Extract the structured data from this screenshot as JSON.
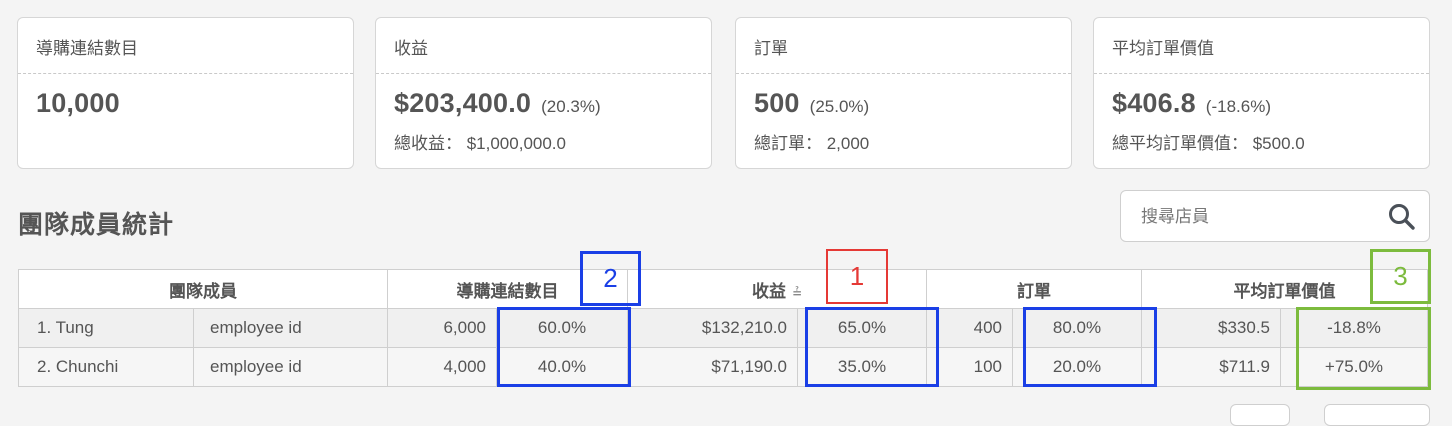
{
  "cards": [
    {
      "title": "導購連結數目",
      "value": "10,000",
      "change": "",
      "sub": ""
    },
    {
      "title": "收益",
      "value": "$203,400.0",
      "change": "(20.3%)",
      "sub": "總收益： $1,000,000.0"
    },
    {
      "title": "訂單",
      "value": "500",
      "change": "(25.0%)",
      "sub": "總訂單： 2,000"
    },
    {
      "title": "平均訂單價值",
      "value": "$406.8",
      "change": "(-18.6%)",
      "sub": "總平均訂單價值： $500.0"
    }
  ],
  "section_title": "團隊成員統計",
  "search": {
    "placeholder": "搜尋店員",
    "value": ""
  },
  "table": {
    "headers": {
      "member": "團隊成員",
      "links": "導購連結數目",
      "revenue": "收益",
      "orders": "訂單",
      "aov": "平均訂單價值"
    },
    "rows": [
      {
        "name": "1. Tung",
        "employee_id": "employee id",
        "links": "6,000",
        "links_pct": "60.0%",
        "revenue": "$132,210.0",
        "revenue_pct": "65.0%",
        "orders": "400",
        "orders_pct": "80.0%",
        "aov": "$330.5",
        "aov_pct": "-18.8%"
      },
      {
        "name": "2. Chunchi",
        "employee_id": "employee id",
        "links": "4,000",
        "links_pct": "40.0%",
        "revenue": "$71,190.0",
        "revenue_pct": "35.0%",
        "orders": "100",
        "orders_pct": "20.0%",
        "aov": "$711.9",
        "aov_pct": "+75.0%"
      }
    ]
  },
  "annotations": {
    "label_1": "1",
    "label_2": "2",
    "label_3": "3"
  },
  "colors": {
    "blue": "#1a3fe6",
    "red": "#e53935",
    "green": "#7cbb3d"
  }
}
